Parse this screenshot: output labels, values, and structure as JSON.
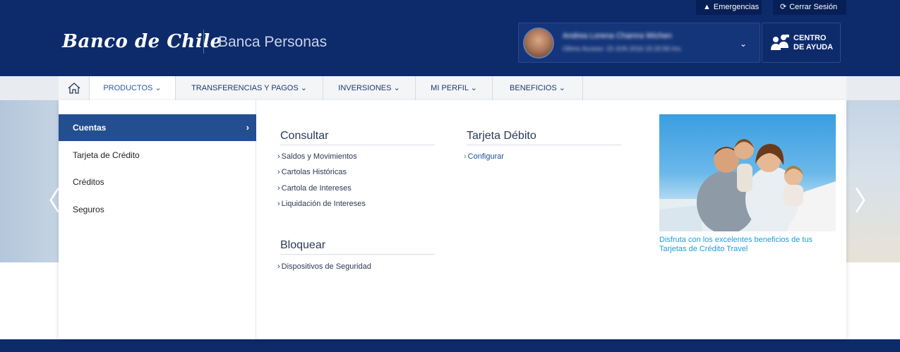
{
  "header": {
    "top_links": [
      {
        "label": "Emergencias",
        "icon": "warning-icon"
      },
      {
        "label": "Cerrar Sesión",
        "icon": "logout-icon"
      }
    ],
    "logo": "Banco de Chile",
    "section": "Banca Personas",
    "user": {
      "name": "Andrea Lorena Chamra Wichen",
      "last_access": "Último Acceso: 23 JUN 2016 15:20:56 hrs."
    },
    "help": {
      "line1": "CENTRO",
      "line2": "DE AYUDA"
    }
  },
  "nav": {
    "items": [
      {
        "label": "PRODUCTOS ⌄"
      },
      {
        "label": "TRANSFERENCIAS Y PAGOS ⌄"
      },
      {
        "label": "INVERSIONES ⌄"
      },
      {
        "label": "MI PERFIL ⌄"
      },
      {
        "label": "BENEFICIOS ⌄"
      }
    ]
  },
  "menu": {
    "categories": [
      {
        "label": "Cuentas"
      },
      {
        "label": "Tarjeta de Crédito"
      },
      {
        "label": "Créditos"
      },
      {
        "label": "Seguros"
      }
    ],
    "consultar": {
      "title": "Consultar",
      "links": [
        "Saldos y Movimientos",
        "Cartolas Históricas",
        "Cartola de Intereses",
        "Liquidación de Intereses"
      ]
    },
    "bloquear": {
      "title": "Bloquear",
      "links": [
        "Dispositivos de Seguridad"
      ]
    },
    "tarjeta_debito": {
      "title": "Tarjeta Débito",
      "links": [
        "Configurar"
      ]
    },
    "promo": {
      "text": "Disfruta con los excelentes beneficios de tus Tarjetas de Crédito Travel"
    }
  },
  "colors": {
    "brand_navy": "#0d2b6b",
    "active_category": "#234f91",
    "promo_link": "#1aa0d8"
  }
}
